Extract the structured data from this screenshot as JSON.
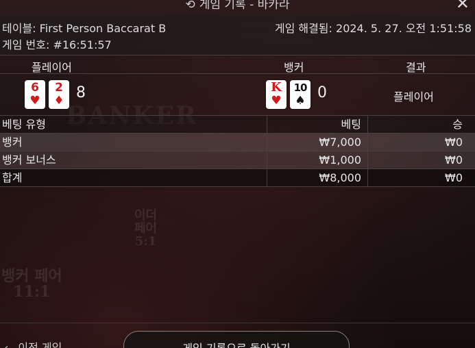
{
  "titlebar": {
    "title": "게임 기록 - 바카라",
    "history_icon": "history-clock-icon",
    "close_icon": "close-icon",
    "close_glyph": "✕"
  },
  "info": {
    "table_label": "테이블:",
    "table_value": "First Person Baccarat B",
    "game_id_label": "게임 번호:",
    "game_id_value": "#16:51:57",
    "resolved_label": "게임 해결됨:",
    "resolved_value": "2024. 5. 27. 오전 1:51:58"
  },
  "columns": {
    "player": "플레이어",
    "banker": "뱅커",
    "result": "결과"
  },
  "hand": {
    "player_cards": [
      {
        "rank": "6",
        "suit": "♥",
        "color": "#d11a1a"
      },
      {
        "rank": "2",
        "suit": "♦",
        "color": "#d11a1a"
      }
    ],
    "player_score": "8",
    "banker_cards": [
      {
        "rank": "K",
        "suit": "♥",
        "color": "#d11a1a"
      },
      {
        "rank": "10",
        "suit": "♠",
        "color": "#111111"
      }
    ],
    "banker_score": "0",
    "result": "플레이어"
  },
  "bets": {
    "headers": {
      "type": "베팅 유형",
      "bet": "베팅",
      "win": "승"
    },
    "rows": [
      {
        "type": "뱅커",
        "bet": "₩7,000",
        "win": "₩0"
      },
      {
        "type": "뱅커 보너스",
        "bet": "₩1,000",
        "win": "₩0"
      }
    ],
    "total": {
      "type": "합계",
      "bet": "₩8,000",
      "win": "₩0"
    }
  },
  "felt": {
    "either_pair_lines": [
      "이더",
      "페어",
      "5:1"
    ],
    "banker_pair_lines": [
      "뱅커 페어",
      "11:1"
    ]
  },
  "footer": {
    "prev_game": "이전 게임",
    "prev_icon": "chevron-left-icon",
    "prev_glyph": "‹",
    "back_button": "게임 기록으로 돌아가기"
  }
}
